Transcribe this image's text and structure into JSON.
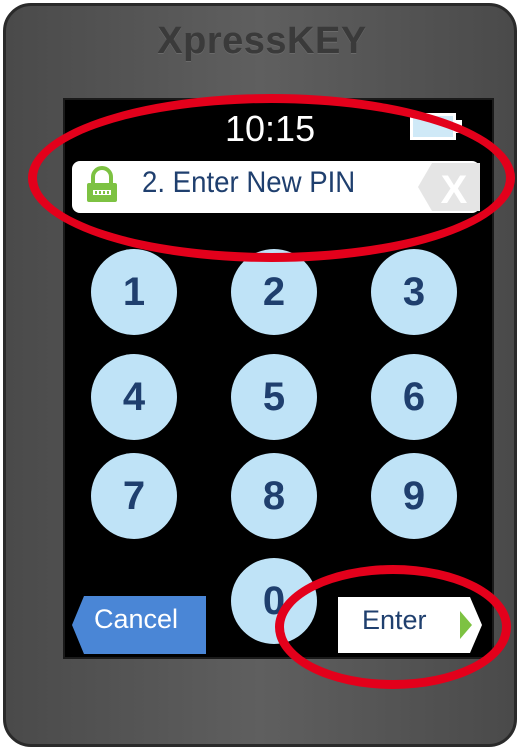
{
  "device": {
    "brand": "XpressKEY"
  },
  "status": {
    "time": "10:15"
  },
  "header": {
    "prompt": "2. Enter New PIN"
  },
  "keypad": {
    "keys": [
      "1",
      "2",
      "3",
      "4",
      "5",
      "6",
      "7",
      "8",
      "9",
      "0"
    ]
  },
  "buttons": {
    "cancel": "Cancel",
    "enter": "Enter"
  },
  "icons": {
    "lock": "lock-icon",
    "clear": "clear-x-icon",
    "battery": "battery-icon",
    "enter_arrow": "arrow-right-icon"
  },
  "colors": {
    "key_fill": "#bfe3f7",
    "key_text": "#1f3f6e",
    "cancel_fill": "#4a86d6",
    "lock_green": "#7dc242",
    "annotation_red": "#e3001b",
    "screen": "#000000"
  }
}
